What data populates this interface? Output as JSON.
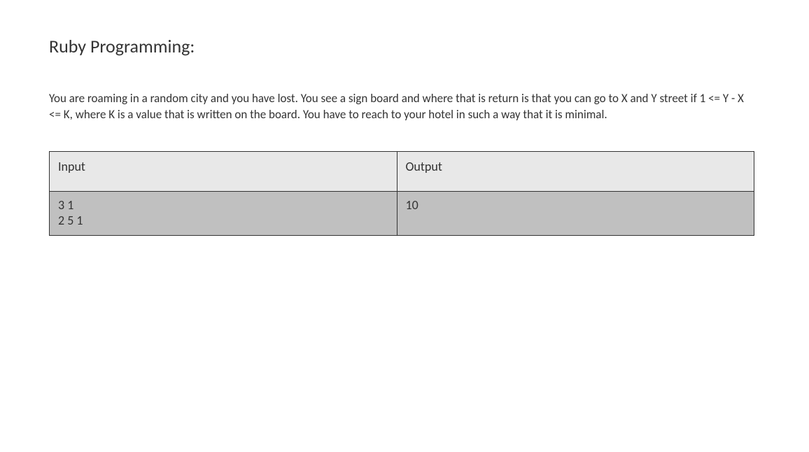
{
  "title": "Ruby Programming:",
  "description": "You are roaming in a random city and you have lost. You see a sign board and where that is return is that you can go to X and Y street if 1 <= Y - X <= K, where K is a value that is written on the board. You have to reach to your hotel in such a way that it is minimal.",
  "table": {
    "headers": {
      "input": "Input",
      "output": "Output"
    },
    "row": {
      "input": "3 1\n2 5 1",
      "output": "10"
    }
  }
}
